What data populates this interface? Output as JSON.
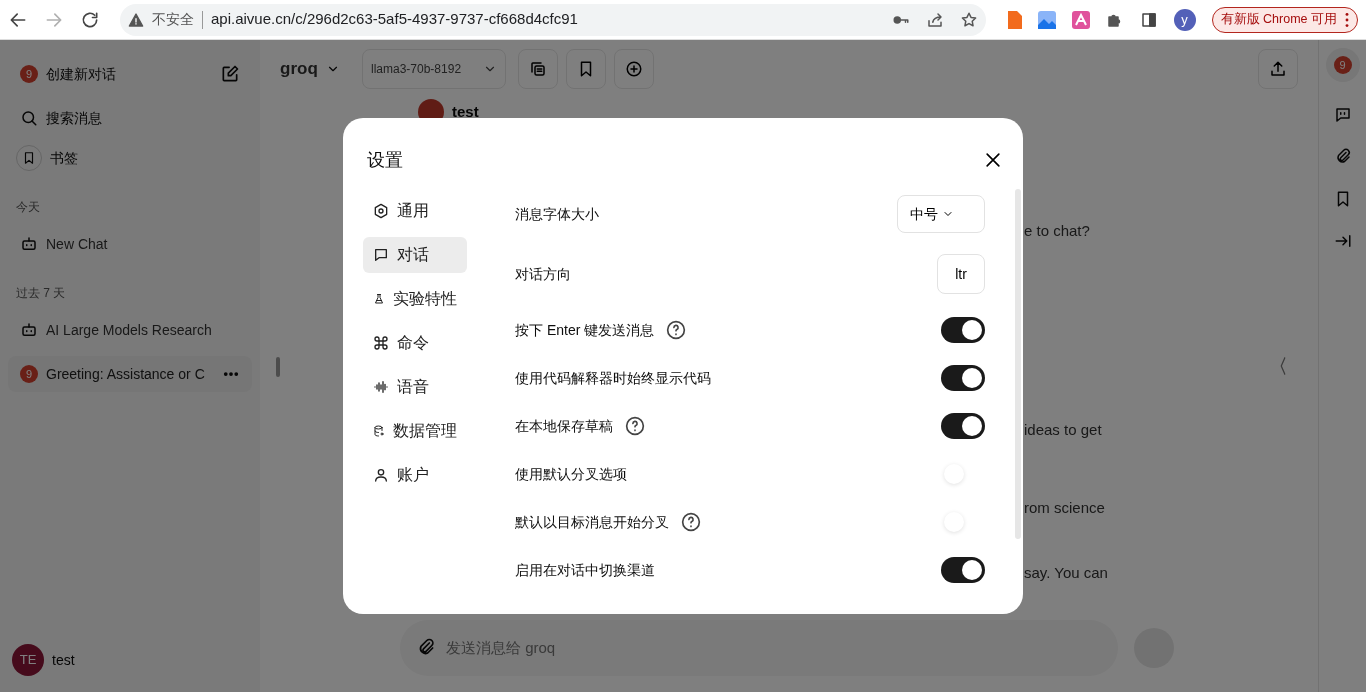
{
  "browser": {
    "nav_buttons": [
      {
        "kind": "back",
        "disabled": false
      },
      {
        "kind": "forward",
        "disabled": true
      },
      {
        "kind": "reload",
        "disabled": false
      }
    ],
    "security": "不安全",
    "url": "api.aivue.cn/c/296d2c63-5af5-4937-9737-cf668d4cfc91",
    "profile": "y",
    "update_button": "有新版 Chrome 可用"
  },
  "sidebar": {
    "new_chat": {
      "badge": "9",
      "label": "创建新对话"
    },
    "search": "搜索消息",
    "bookmarks": "书签",
    "groups": [
      {
        "heading": "今天",
        "chats": [
          {
            "title": "New Chat",
            "kind": "bot",
            "selected": false
          }
        ]
      },
      {
        "heading": "过去 7 天",
        "chats": [
          {
            "title": "AI Large Models Research",
            "kind": "bot",
            "selected": false
          },
          {
            "title": "Greeting: Assistance or C",
            "kind": "badge",
            "badge": "9",
            "selected": true
          }
        ]
      }
    ],
    "user": {
      "initials": "TE",
      "name": "test"
    }
  },
  "header": {
    "endpoint": "groq",
    "model": "llama3-70b-8192"
  },
  "chat": {
    "author": "test",
    "fragments": [
      "e to chat?",
      "ideas to get",
      "rom science",
      "say. You can"
    ]
  },
  "input": {
    "placeholder": "发送消息给 groq"
  },
  "rail": {
    "badge": "9"
  },
  "settings": {
    "title": "设置",
    "tabs": [
      {
        "label": "通用",
        "kind": "gear",
        "selected": false
      },
      {
        "label": "对话",
        "kind": "chat",
        "selected": true
      },
      {
        "label": "实验特性",
        "kind": "flask",
        "selected": false
      },
      {
        "label": "命令",
        "kind": "command",
        "selected": false
      },
      {
        "label": "语音",
        "kind": "audio",
        "selected": false
      },
      {
        "label": "数据管理",
        "kind": "database",
        "selected": false
      },
      {
        "label": "账户",
        "kind": "user",
        "selected": false
      }
    ],
    "rows": [
      {
        "label": "消息字体大小",
        "kind": "select",
        "value": "中号"
      },
      {
        "label": "对话方向",
        "kind": "button",
        "value": "ltr"
      },
      {
        "label": "按下 Enter 键发送消息",
        "kind": "toggle",
        "on": true,
        "help": true
      },
      {
        "label": "使用代码解释器时始终显示代码",
        "kind": "toggle",
        "on": true,
        "help": false
      },
      {
        "label": "在本地保存草稿",
        "kind": "toggle",
        "on": true,
        "help": true
      },
      {
        "label": "使用默认分叉选项",
        "kind": "toggle",
        "on": false,
        "help": false
      },
      {
        "label": "默认以目标消息开始分叉",
        "kind": "toggle",
        "on": false,
        "help": true
      },
      {
        "label": "启用在对话中切换渠道",
        "kind": "toggle",
        "on": true,
        "help": false
      }
    ]
  }
}
